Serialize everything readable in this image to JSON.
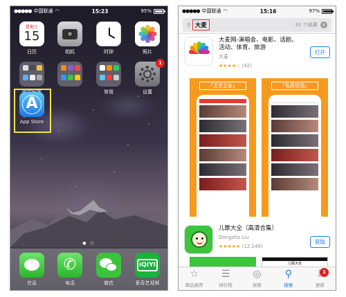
{
  "left_phone": {
    "status": {
      "carrier": "中国联通",
      "time": "15:23",
      "battery": "95%",
      "battery_level": 0.95
    },
    "apps": [
      {
        "label": "日历",
        "weekday": "星期三",
        "day": "15"
      },
      {
        "label": "相机"
      },
      {
        "label": "时钟"
      },
      {
        "label": "照片"
      },
      {
        "label": "附加程序"
      },
      {
        "label": ""
      },
      {
        "label": "常用"
      },
      {
        "label": "设置",
        "badge": "1"
      },
      {
        "label": "App Store"
      }
    ],
    "dock": [
      {
        "label": "信息"
      },
      {
        "label": "电话"
      },
      {
        "label": "微信"
      },
      {
        "label": "爱奇艺视频",
        "icon_text": "iQIYI"
      }
    ]
  },
  "right_phone": {
    "status": {
      "carrier": "中国联通",
      "time": "15:16",
      "battery": "97%",
      "battery_level": 0.97
    },
    "search": {
      "query": "大麦",
      "count": "91 个结果"
    },
    "results": [
      {
        "title_line1": "大麦网-演唱会、电影、话剧、",
        "title_line2": "活动、体育、旅游",
        "developer": "大麦",
        "stars": "★★★★☆",
        "rating_count": "(42)",
        "action": "打开"
      },
      {
        "title_line1": "儿歌大全（高清合集）",
        "developer": "Dongsha Liu",
        "stars": "★★★★★",
        "rating_count": "(12,149)",
        "action": "获取"
      }
    ],
    "screenshots": [
      {
        "banner": "「文艺主张」"
      },
      {
        "banner": "「免费现场」"
      }
    ],
    "peek_title": "儿歌大全",
    "tabs": [
      {
        "label": "精品推荐",
        "icon": "star-icon"
      },
      {
        "label": "排行榜",
        "icon": "list-icon"
      },
      {
        "label": "探索",
        "icon": "compass-icon"
      },
      {
        "label": "搜索",
        "icon": "search-icon"
      },
      {
        "label": "更新",
        "icon": "download-icon",
        "badge": "1"
      }
    ],
    "active_tab": "搜索"
  },
  "colors": {
    "ios_blue": "#1e7cf2",
    "highlight_red": "#e53935",
    "highlight_yellow": "#f2e44a",
    "screenshot_orange": "#f59a1e"
  }
}
